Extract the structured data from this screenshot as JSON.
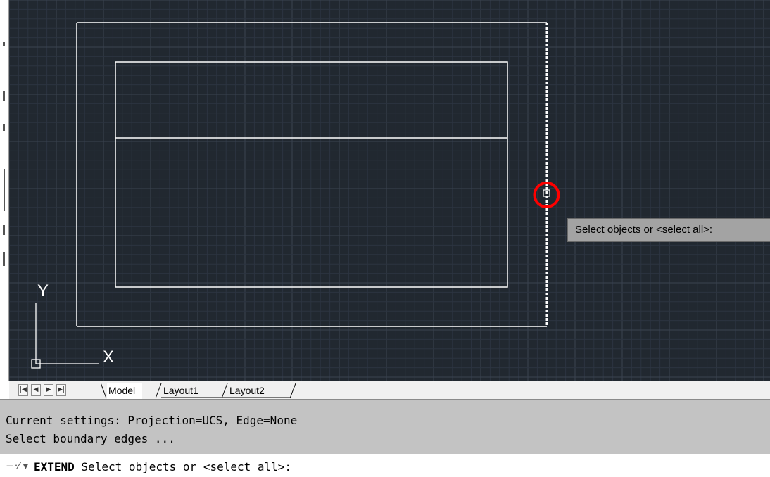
{
  "drawing": {
    "grid_color": "#2c3441",
    "background": "#212830",
    "line_color": "#ffffff",
    "highlight_color": "#ff0000",
    "ucs_x_label": "X",
    "ucs_y_label": "Y"
  },
  "tooltip": {
    "text": "Select objects or <select all>:"
  },
  "tabs": {
    "nav_icons": [
      "first-icon",
      "prev-icon",
      "next-icon",
      "last-icon"
    ],
    "nav_glyphs": [
      "|◀",
      "◀",
      "▶",
      "▶|"
    ],
    "model": "Model",
    "layout1": "Layout1",
    "layout2": "Layout2"
  },
  "history": {
    "lines": [
      "Current settings: Projection=UCS, Edge=None",
      "Select boundary edges ..."
    ]
  },
  "command": {
    "icon": "command-icon",
    "icon_glyph": "−·⁄ ▾",
    "name": "EXTEND",
    "prompt": " Select objects or <select all>:"
  }
}
